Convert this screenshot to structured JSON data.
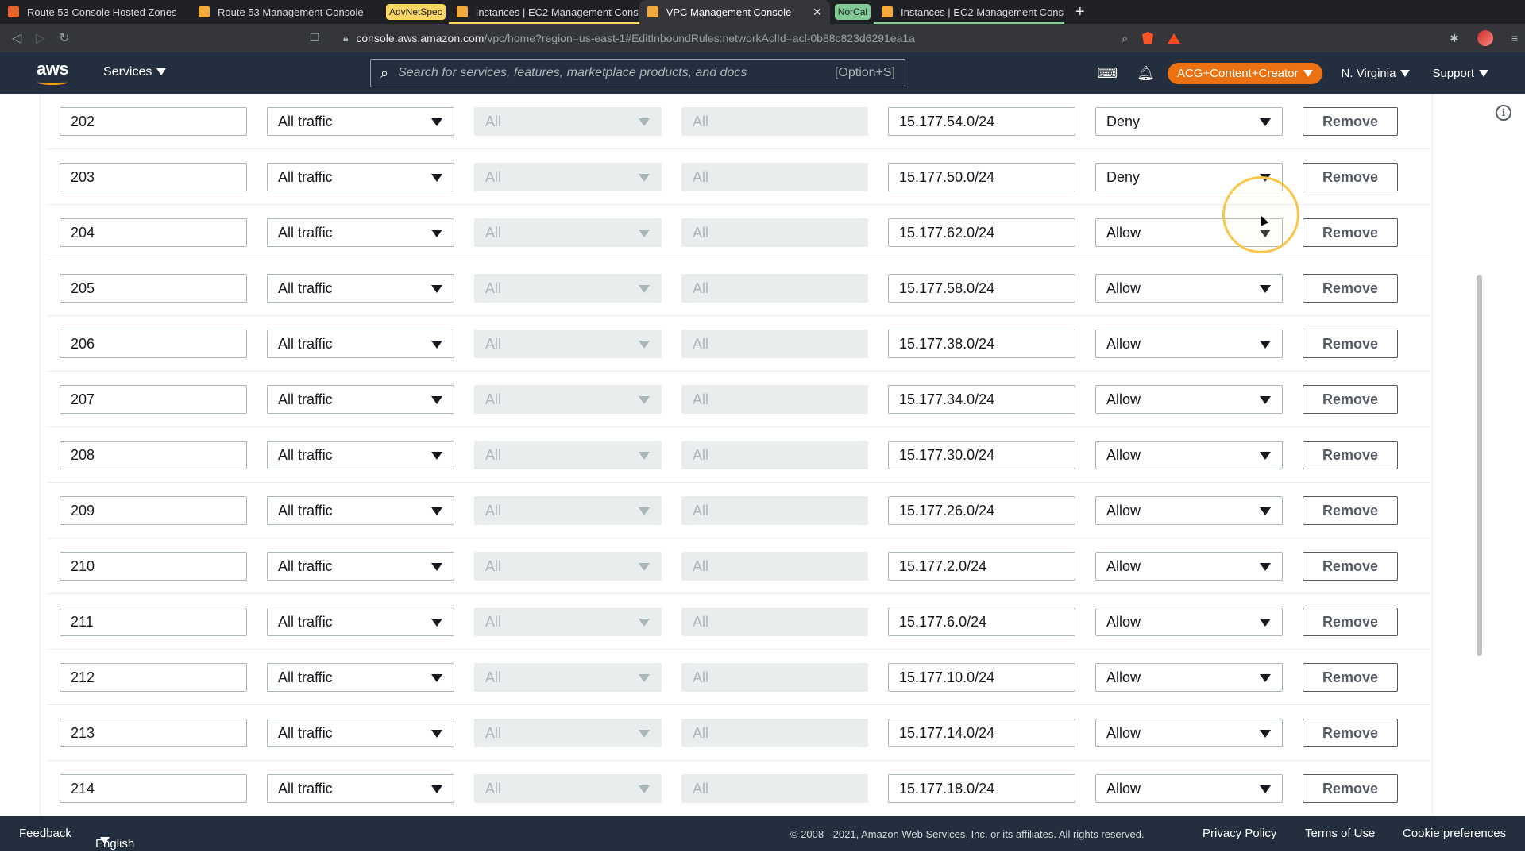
{
  "browser": {
    "tabs": [
      {
        "label": "Route 53 Console Hosted Zones",
        "favicon_color": "#e8642f",
        "group": null,
        "active": false
      },
      {
        "label": "Route 53 Management Console",
        "favicon_color": "#f3a93b",
        "group": null,
        "active": false
      },
      {
        "label": "Instances | EC2 Management Cons",
        "favicon_color": "#f3a93b",
        "group": "AdvNetSpec",
        "active": false
      },
      {
        "label": "VPC Management Console",
        "favicon_color": "#f3a93b",
        "group": "AdvNetSpec",
        "active": true
      },
      {
        "label": "Instances | EC2 Management Cons",
        "favicon_color": "#f3a93b",
        "group": "NorCal",
        "active": false
      }
    ],
    "groups": {
      "AdvNetSpec": "#fdd663",
      "NorCal": "#81c995"
    },
    "new_tab_label": "+",
    "url_host": "console.aws.amazon.com",
    "url_path": "/vpc/home?region=us-east-1#EditInboundRules:networkAclId=acl-0b88c823d6291ea1a"
  },
  "aws_nav": {
    "logo": "aws",
    "services_label": "Services",
    "search_placeholder": "Search for services, features, marketplace products, and docs",
    "search_shortcut": "[Option+S]",
    "account_label": "ACG+Content+Creator",
    "region_label": "N. Virginia",
    "support_label": "Support"
  },
  "rules": [
    {
      "rule_number": "202",
      "type": "All traffic",
      "protocol": "All",
      "port_range": "All",
      "source": "15.177.54.0/24",
      "action": "Deny"
    },
    {
      "rule_number": "203",
      "type": "All traffic",
      "protocol": "All",
      "port_range": "All",
      "source": "15.177.50.0/24",
      "action": "Deny"
    },
    {
      "rule_number": "204",
      "type": "All traffic",
      "protocol": "All",
      "port_range": "All",
      "source": "15.177.62.0/24",
      "action": "Allow"
    },
    {
      "rule_number": "205",
      "type": "All traffic",
      "protocol": "All",
      "port_range": "All",
      "source": "15.177.58.0/24",
      "action": "Allow"
    },
    {
      "rule_number": "206",
      "type": "All traffic",
      "protocol": "All",
      "port_range": "All",
      "source": "15.177.38.0/24",
      "action": "Allow"
    },
    {
      "rule_number": "207",
      "type": "All traffic",
      "protocol": "All",
      "port_range": "All",
      "source": "15.177.34.0/24",
      "action": "Allow"
    },
    {
      "rule_number": "208",
      "type": "All traffic",
      "protocol": "All",
      "port_range": "All",
      "source": "15.177.30.0/24",
      "action": "Allow"
    },
    {
      "rule_number": "209",
      "type": "All traffic",
      "protocol": "All",
      "port_range": "All",
      "source": "15.177.26.0/24",
      "action": "Allow"
    },
    {
      "rule_number": "210",
      "type": "All traffic",
      "protocol": "All",
      "port_range": "All",
      "source": "15.177.2.0/24",
      "action": "Allow"
    },
    {
      "rule_number": "211",
      "type": "All traffic",
      "protocol": "All",
      "port_range": "All",
      "source": "15.177.6.0/24",
      "action": "Allow"
    },
    {
      "rule_number": "212",
      "type": "All traffic",
      "protocol": "All",
      "port_range": "All",
      "source": "15.177.10.0/24",
      "action": "Allow"
    },
    {
      "rule_number": "213",
      "type": "All traffic",
      "protocol": "All",
      "port_range": "All",
      "source": "15.177.14.0/24",
      "action": "Allow"
    },
    {
      "rule_number": "214",
      "type": "All traffic",
      "protocol": "All",
      "port_range": "All",
      "source": "15.177.18.0/24",
      "action": "Allow"
    }
  ],
  "remove_label": "Remove",
  "footer": {
    "feedback": "Feedback",
    "language": "English (US)",
    "copyright": "© 2008 - 2021, Amazon Web Services, Inc. or its affiliates. All rights reserved.",
    "privacy": "Privacy Policy",
    "terms": "Terms of Use",
    "cookies": "Cookie preferences"
  },
  "colors": {
    "aws_nav_bg": "#232f3e",
    "account_pill": "#ec7211",
    "click_highlight": "#f7c64b"
  }
}
